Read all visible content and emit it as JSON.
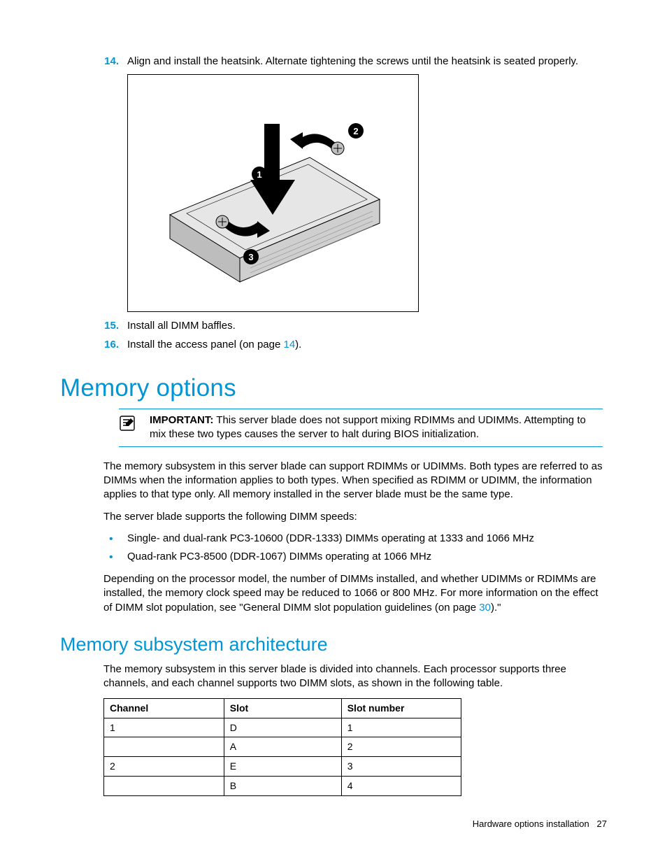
{
  "steps_top": [
    {
      "num": "14.",
      "text": "Align and install the heatsink. Alternate tightening the screws until the heatsink is seated properly."
    }
  ],
  "steps_after_figure": [
    {
      "num": "15.",
      "text": "Install all DIMM baffles."
    },
    {
      "num": "16.",
      "text_prefix": "Install the access panel (on page ",
      "link": "14",
      "text_suffix": ")."
    }
  ],
  "section_memory_options": "Memory options",
  "important": {
    "label": "IMPORTANT:",
    "text": "  This server blade does not support mixing RDIMMs and UDIMMs. Attempting to mix these two types causes the server to halt during BIOS initialization."
  },
  "para1": "The memory subsystem in this server blade can support RDIMMs or UDIMMs. Both types are referred to as DIMMs when the information applies to both types. When specified as RDIMM or UDIMM, the information applies to that type only. All memory installed in the server blade must be the same type.",
  "para2": "The server blade supports the following DIMM speeds:",
  "bullets": [
    "Single- and dual-rank PC3-10600 (DDR-1333) DIMMs operating at 1333 and 1066 MHz",
    "Quad-rank PC3-8500 (DDR-1067) DIMMs operating at 1066 MHz"
  ],
  "para3_prefix": "Depending on the processor model, the number of DIMMs installed, and whether UDIMMs or RDIMMs are installed, the memory clock speed may be reduced to 1066 or 800 MHz. For more information on the effect of DIMM slot population, see \"General DIMM slot population guidelines (on page ",
  "para3_link": "30",
  "para3_suffix": ").\"",
  "section_memory_arch": "Memory subsystem architecture",
  "para4": "The memory subsystem in this server blade is divided into channels. Each processor supports three channels, and each channel supports two DIMM slots, as shown in the following table.",
  "table": {
    "headers": [
      "Channel",
      "Slot",
      "Slot number"
    ],
    "rows": [
      [
        "1",
        "D",
        "1"
      ],
      [
        "",
        "A",
        "2"
      ],
      [
        "2",
        "E",
        "3"
      ],
      [
        "",
        "B",
        "4"
      ]
    ]
  },
  "footer_section": "Hardware options installation",
  "footer_page": "27"
}
